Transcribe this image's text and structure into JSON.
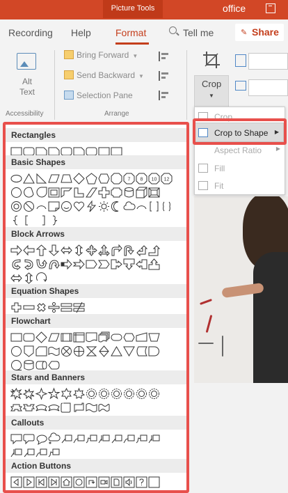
{
  "titlebar": {
    "context_tab": "Picture Tools",
    "app_fragment": "office"
  },
  "ribbon": {
    "tabs": [
      "Recording",
      "Help",
      "Format",
      "Tell me"
    ],
    "share_label": "Share",
    "accessibility": {
      "button_label": "Alt Text",
      "group_label": "Accessibility"
    },
    "arrange": {
      "bring_forward": "Bring Forward",
      "send_backward": "Send Backward",
      "selection_pane": "Selection Pane",
      "group_label": "Arrange"
    },
    "crop": {
      "label": "Crop"
    }
  },
  "crop_menu": {
    "items": [
      {
        "label": "Crop",
        "enabled": false
      },
      {
        "label": "Crop to Shape",
        "enabled": true,
        "highlighted": true
      },
      {
        "label": "Aspect Ratio",
        "enabled": false
      },
      {
        "label": "Fill",
        "enabled": false
      },
      {
        "label": "Fit",
        "enabled": false
      }
    ]
  },
  "shape_gallery": {
    "categories": [
      {
        "name": "Rectangles",
        "count": 9
      },
      {
        "name": "Basic Shapes",
        "count": 42
      },
      {
        "name": "Block Arrows",
        "count": 28
      },
      {
        "name": "Equation Shapes",
        "count": 6
      },
      {
        "name": "Flowchart",
        "count": 28
      },
      {
        "name": "Stars and Banners",
        "count": 20
      },
      {
        "name": "Callouts",
        "count": 16
      },
      {
        "name": "Action Buttons",
        "count": 12
      }
    ],
    "numbered_octagons": [
      "7",
      "8",
      "10",
      "12"
    ]
  },
  "colors": {
    "accent": "#c43e1c",
    "highlight_border": "#e8504c",
    "titlebar": "#d24726"
  }
}
